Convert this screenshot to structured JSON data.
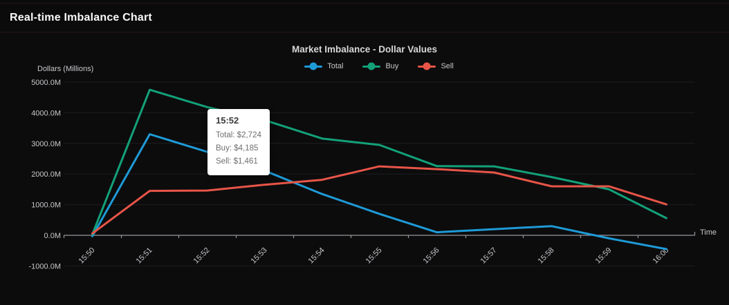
{
  "header": {
    "title": "Real-time Imbalance Chart"
  },
  "chart": {
    "title": "Market Imbalance - Dollar Values",
    "y_axis_unit": "Dollars (Millions)",
    "x_axis_label": "Time"
  },
  "tooltip": {
    "title": "15:52",
    "rows": [
      "Total: $2,724",
      "Buy: $4,185",
      "Sell: $1,461"
    ]
  },
  "colors": {
    "total": "#1e9bd7",
    "buy": "#13a179",
    "sell": "#e85548",
    "axis": "#97979c",
    "grid": "#1e1e21",
    "tick_text": "#c9c9cc"
  },
  "chart_data": {
    "type": "line",
    "title": "Market Imbalance - Dollar Values",
    "xlabel": "Time",
    "ylabel": "Dollars (Millions)",
    "categories": [
      "15:50",
      "15:51",
      "15:52",
      "15:53",
      "15:54",
      "15:55",
      "15:56",
      "15:57",
      "15:58",
      "15:59",
      "16:00"
    ],
    "series": [
      {
        "name": "Total",
        "color": "#1e9bd7",
        "values": [
          -30,
          3300,
          2724,
          2110,
          1350,
          700,
          100,
          200,
          300,
          -100,
          -450
        ]
      },
      {
        "name": "Buy",
        "color": "#13a179",
        "values": [
          30,
          4750,
          4185,
          3760,
          3160,
          2950,
          2260,
          2250,
          1900,
          1500,
          560
        ]
      },
      {
        "name": "Sell",
        "color": "#e85548",
        "values": [
          60,
          1450,
          1461,
          1650,
          1810,
          2250,
          2160,
          2050,
          1600,
          1600,
          1010
        ]
      }
    ],
    "y_ticks": {
      "labels": [
        "5000.0M",
        "4000.0M",
        "3000.0M",
        "2000.0M",
        "1000.0M",
        "0.0M",
        "-1000.0M"
      ],
      "values": [
        5000,
        4000,
        3000,
        2000,
        1000,
        0,
        -1000
      ]
    },
    "ylim": [
      -1000,
      5000
    ],
    "grid": true,
    "legend_position": "top",
    "tooltip_point": {
      "category": "15:52",
      "values": {
        "Total": 2724,
        "Buy": 4185,
        "Sell": 1461
      }
    }
  }
}
